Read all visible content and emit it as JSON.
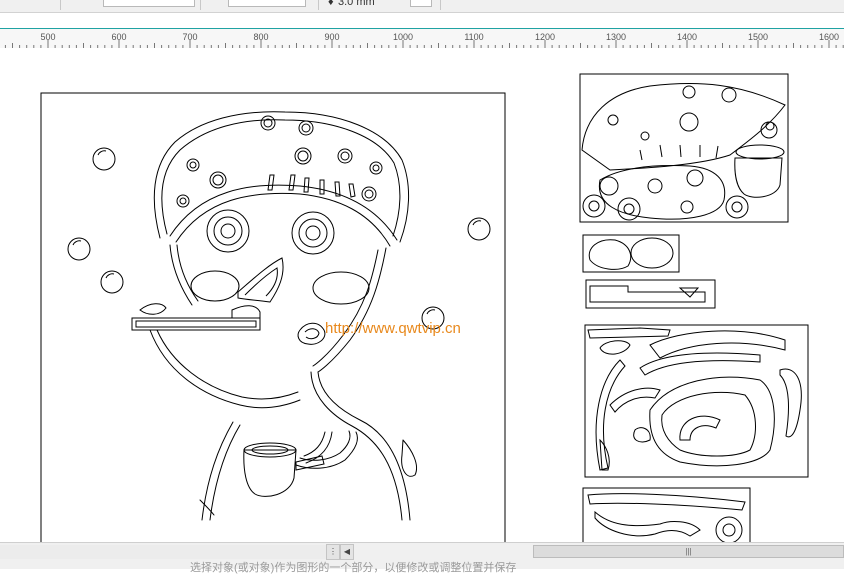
{
  "toolbar": {
    "size_value": "3.0 mm"
  },
  "ruler": {
    "labels": [
      "500",
      "600",
      "700",
      "800",
      "900",
      "1000",
      "1100",
      "1200",
      "1300",
      "1400",
      "1500",
      "1600"
    ]
  },
  "canvas": {
    "watermark": "http://www.qwtvip.cn"
  },
  "statusbar": {
    "hint": "选择对象(或对象)作为图形的一个部分，以便修改或调整位置并保存"
  },
  "colors": {
    "ruler_accent": "#1fa3a3",
    "watermark": "#e8891d"
  }
}
